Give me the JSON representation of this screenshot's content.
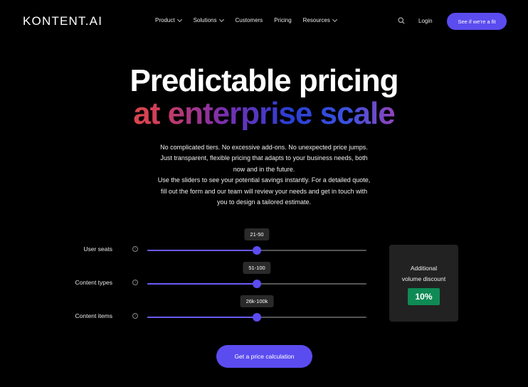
{
  "nav": {
    "logo": "KONTENT.AI",
    "items": [
      {
        "label": "Product",
        "has_dropdown": true
      },
      {
        "label": "Solutions",
        "has_dropdown": true
      },
      {
        "label": "Customers",
        "has_dropdown": false
      },
      {
        "label": "Pricing",
        "has_dropdown": false
      },
      {
        "label": "Resources",
        "has_dropdown": true
      }
    ],
    "search_icon": "search-icon",
    "login": "Login",
    "cta": "See if we're a fit"
  },
  "hero": {
    "title_line1": "Predictable pricing",
    "title_line2": "at enterprise scale",
    "description": [
      "No complicated tiers. No excessive add-ons. No unexpected price jumps.",
      "Just transparent, flexible pricing that adapts to your business needs, both",
      "now and in the future.",
      "Use the sliders to see your potential savings instantly. For a detailed quote,",
      "fill out the form and our team will review your needs and get in touch with",
      "you to design a tailored estimate."
    ]
  },
  "sliders": [
    {
      "label": "User seats",
      "value_label": "21-50",
      "fill_fraction": 0.5
    },
    {
      "label": "Content types",
      "value_label": "51-100",
      "fill_fraction": 0.5
    },
    {
      "label": "Content items",
      "value_label": "26k-100k",
      "fill_fraction": 0.5
    }
  ],
  "discount": {
    "label_line1": "Additional",
    "label_line2": "volume discount",
    "value": "10%"
  },
  "cta_bottom": "Get a price calculation",
  "colors": {
    "accent": "#5b4cf0",
    "discount_badge": "#0f8a55",
    "background": "#000000"
  }
}
